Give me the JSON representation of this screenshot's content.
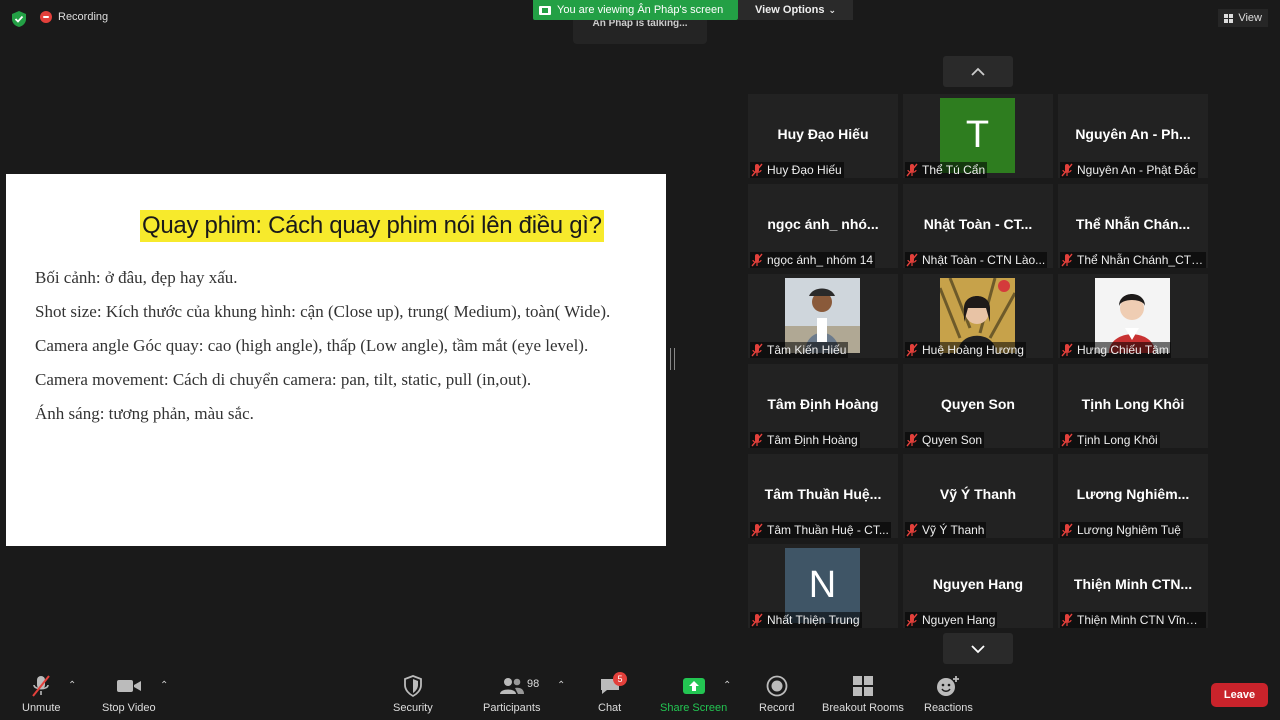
{
  "topbar": {
    "recording_label": "Recording",
    "viewing_banner": "You are viewing Ân Pháp's screen",
    "view_options_label": "View Options",
    "talking_label": "Ân Pháp is talking...",
    "view_label": "View"
  },
  "slide": {
    "title": "Quay phim: Cách quay phim nói lên điều gì?",
    "lines": [
      "Bối cảnh: ở đâu, đẹp hay xấu.",
      "Shot size: Kích thước của khung hình: cận (Close up), trung( Medium), toàn( Wide).",
      "Camera angle Góc quay: cao (high angle), thấp (Low angle), tầm mắt (eye level).",
      "Camera movement: Cách di chuyển camera: pan, tilt, static, pull (in,out).",
      "Ánh sáng: tương phản, màu sắc."
    ]
  },
  "gallery": {
    "tiles": [
      {
        "big": "Huy Đạo Hiếu",
        "label": "Huy Đạo Hiếu"
      },
      {
        "avatar": "T",
        "avatar_color": "#2e7d1f",
        "label": "Thể Tú Cẩn"
      },
      {
        "big": "Nguyên An - Ph...",
        "label": "Nguyên An - Phật Đắc"
      },
      {
        "big": "ngọc ánh_ nhó...",
        "label": "ngọc ánh_ nhóm 14"
      },
      {
        "big": "Nhật Toàn - CT...",
        "label": "Nhật Toàn - CTN Lào..."
      },
      {
        "big": "Thể Nhẫn Chán...",
        "label": "Thể Nhẫn Chánh_CTN..."
      },
      {
        "photo": "person-outdoor",
        "label": "Tâm Kiến Hiếu"
      },
      {
        "photo": "person-plants",
        "label": "Huệ Hoàng Hương"
      },
      {
        "photo": "person-portrait",
        "label": "Hưng Chiếu Tâm"
      },
      {
        "big": "Tâm Định Hoàng",
        "label": "Tâm Định Hoàng"
      },
      {
        "big": "Quyen Son",
        "label": "Quyen Son"
      },
      {
        "big": "Tịnh Long Khôi",
        "label": "Tịnh Long Khôi"
      },
      {
        "big": "Tâm Thuần Huệ...",
        "label": "Tâm Thuần Huệ - CT..."
      },
      {
        "big": "Vỹ Ý Thanh",
        "label": "Vỹ Ý Thanh"
      },
      {
        "big": "Lương  Nghiêm...",
        "label": "Lương Nghiêm Tuệ"
      },
      {
        "avatar": "N",
        "avatar_color": "#3f5566",
        "label": "Nhất Thiện Trung"
      },
      {
        "big": "Nguyen Hang",
        "label": "Nguyen Hang"
      },
      {
        "big": "Thiện Minh  CTN...",
        "label": "Thiện Minh CTN Vĩnh ..."
      }
    ]
  },
  "toolbar": {
    "unmute": "Unmute",
    "stop_video": "Stop Video",
    "security": "Security",
    "participants": "Participants",
    "participants_count": "98",
    "chat": "Chat",
    "chat_badge": "5",
    "share_screen": "Share Screen",
    "record": "Record",
    "breakout_rooms": "Breakout Rooms",
    "reactions": "Reactions",
    "leave": "Leave"
  },
  "colors": {
    "share_green": "#23a045",
    "leave_red": "#c9232b",
    "highlight_yellow": "#f7ea2c"
  }
}
